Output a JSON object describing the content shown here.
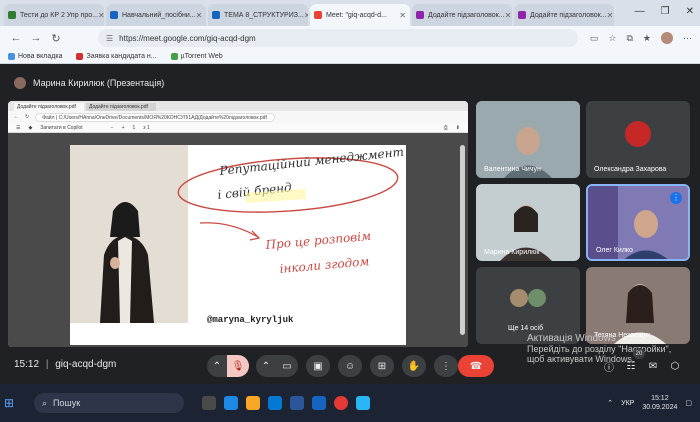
{
  "browser": {
    "tabs": [
      {
        "label": "Тести до КР 2 Упр про...",
        "color": "#2e7d32"
      },
      {
        "label": "Навчальний_посібни...",
        "color": "#1565c0"
      },
      {
        "label": "ТЕМА 8_СТРУКТУРИЗ...",
        "color": "#1565c0"
      },
      {
        "label": "Meet: \"giq-acqd-d...",
        "color": "#ea4335"
      },
      {
        "label": "Додайте підзаголовок...",
        "color": "#8e24aa"
      },
      {
        "label": "Додайте підзаголовок...",
        "color": "#8e24aa"
      }
    ],
    "url": "https://meet.google.com/giq-acqd-dgm",
    "bookmarks": [
      {
        "label": "Нова вкладка",
        "color": "#4a90e2"
      },
      {
        "label": "Заявка кандидата н...",
        "color": "#d32f2f"
      },
      {
        "label": "µTorrent Web",
        "color": "#43a047"
      }
    ]
  },
  "meet": {
    "presenter_label": "Марина Кирилюк (Презентація)",
    "meeting_code": "giq-acqd-dgm",
    "time": "15:12",
    "shared": {
      "tabs": [
        "Додайте підзаголовок.pdf",
        "Додайте підзаголовок.pdf"
      ],
      "url": "Файл  |  C:/Users/HAnna/OneDrive/Documents/МОЯ%20КОНСУЛ/1АД/Додайте%20підзаголовок.pdf",
      "toolbar_text": "Запитати в Copilot",
      "page_indicator": "1",
      "page_of": "з 1",
      "handwriting_1": "Репутаційний менеджмент і свій бренд",
      "handwriting_2": "Про це розповім інколи згодом",
      "handle": "@maryna_kyryljuk"
    },
    "participants": [
      {
        "name": "Валентина Чичун",
        "bg": "#8fa0a8"
      },
      {
        "name": "Олександра Захарова",
        "bg": "#3c4043"
      },
      {
        "name": "Марина Кирилюк",
        "bg": "#aab8bd"
      },
      {
        "name": "Олег Килко",
        "bg": "#6d6aa0"
      },
      {
        "name": "Ще 14 осіб",
        "bg": "#3c4043"
      },
      {
        "name": "Тетяна Незвещук",
        "bg": "#7a6a66"
      }
    ],
    "overflow_count": "20",
    "watermark_title": "Активація Windows",
    "watermark_sub": "Перейдіть до розділу \"Настройки\", щоб активувати Windows."
  },
  "taskbar": {
    "search_placeholder": "Пошук",
    "lang": "УКР",
    "clock_time": "15:12",
    "clock_date": "30.09.2024"
  }
}
